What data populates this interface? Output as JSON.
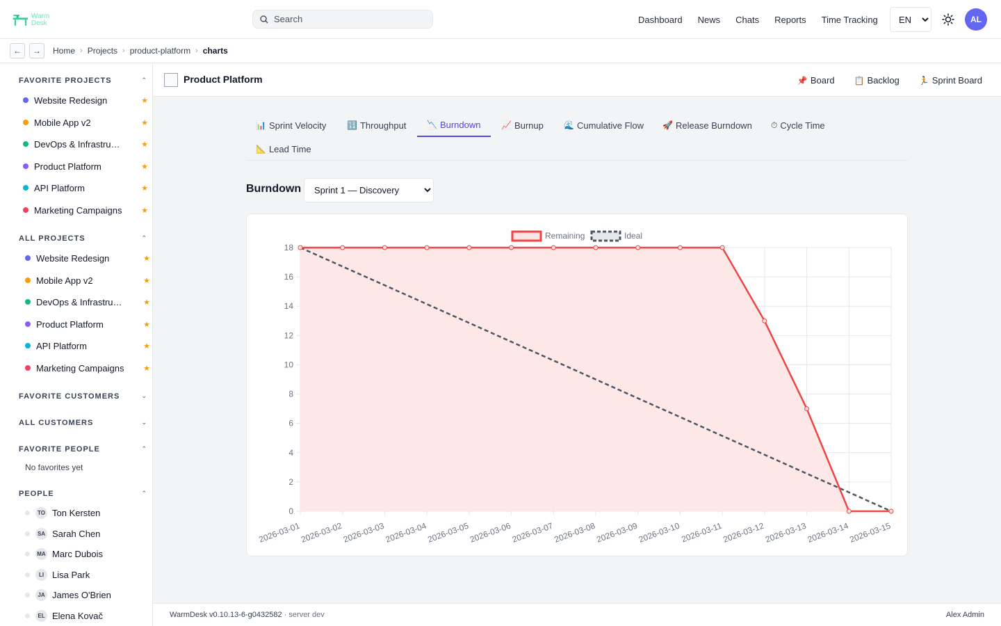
{
  "header": {
    "logo_text": "Warm Desk",
    "search_placeholder": "Search",
    "nav": [
      "Dashboard",
      "News",
      "Chats",
      "Reports",
      "Time Tracking"
    ],
    "language": "EN",
    "avatar_initials": "AL",
    "accent_color": "#6366f1"
  },
  "breadcrumb": {
    "back": "←",
    "forward": "→",
    "items": [
      "Home",
      "Projects",
      "product-platform"
    ],
    "current": "charts"
  },
  "sidebar": {
    "favorite_projects": {
      "title": "FAVORITE PROJECTS",
      "items": [
        {
          "label": "Website Redesign",
          "color": "#6366f1"
        },
        {
          "label": "Mobile App v2",
          "color": "#f59e0b"
        },
        {
          "label": "DevOps & Infrastructure",
          "color": "#10b981"
        },
        {
          "label": "Product Platform",
          "color": "#8b5cf6"
        },
        {
          "label": "API Platform",
          "color": "#06b6d4"
        },
        {
          "label": "Marketing Campaigns",
          "color": "#f43f5e"
        }
      ]
    },
    "all_projects": {
      "title": "ALL PROJECTS",
      "items": [
        {
          "label": "Website Redesign",
          "color": "#6366f1"
        },
        {
          "label": "Mobile App v2",
          "color": "#f59e0b"
        },
        {
          "label": "DevOps & Infrastructure",
          "color": "#10b981"
        },
        {
          "label": "Product Platform",
          "color": "#8b5cf6"
        },
        {
          "label": "API Platform",
          "color": "#06b6d4"
        },
        {
          "label": "Marketing Campaigns",
          "color": "#f43f5e"
        }
      ]
    },
    "favorite_customers": {
      "title": "FAVORITE CUSTOMERS"
    },
    "all_customers": {
      "title": "ALL CUSTOMERS"
    },
    "favorite_people": {
      "title": "FAVORITE PEOPLE",
      "empty": "No favorites yet"
    },
    "people": {
      "title": "PEOPLE",
      "items": [
        {
          "initials": "TO",
          "name": "Ton Kersten"
        },
        {
          "initials": "SA",
          "name": "Sarah Chen"
        },
        {
          "initials": "MA",
          "name": "Marc Dubois"
        },
        {
          "initials": "LI",
          "name": "Lisa Park"
        },
        {
          "initials": "JA",
          "name": "James O'Brien"
        },
        {
          "initials": "EL",
          "name": "Elena Kovač"
        }
      ]
    }
  },
  "project": {
    "title": "Product Platform",
    "actions": [
      {
        "icon": "pin-icon",
        "label": "Board"
      },
      {
        "icon": "clipboard-icon",
        "label": "Backlog"
      },
      {
        "icon": "runner-icon",
        "label": "Sprint Board"
      }
    ]
  },
  "tabs": [
    {
      "icon": "📊",
      "label": "Sprint Velocity"
    },
    {
      "icon": "🔢",
      "label": "Throughput"
    },
    {
      "icon": "📉",
      "label": "Burndown",
      "active": true
    },
    {
      "icon": "📈",
      "label": "Burnup"
    },
    {
      "icon": "🌊",
      "label": "Cumulative Flow"
    },
    {
      "icon": "🚀",
      "label": "Release Burndown"
    },
    {
      "icon": "⏱",
      "label": "Cycle Time"
    },
    {
      "icon": "📐",
      "label": "Lead Time"
    }
  ],
  "burndown": {
    "heading": "Burndown",
    "sprint_selected": "Sprint 1 — Discovery"
  },
  "chart_data": {
    "type": "line",
    "x": [
      "2026-03-01",
      "2026-03-02",
      "2026-03-03",
      "2026-03-04",
      "2026-03-05",
      "2026-03-06",
      "2026-03-07",
      "2026-03-08",
      "2026-03-09",
      "2026-03-10",
      "2026-03-11",
      "2026-03-12",
      "2026-03-13",
      "2026-03-14",
      "2026-03-15"
    ],
    "series": [
      {
        "name": "Remaining",
        "values": [
          18,
          18,
          18,
          18,
          18,
          18,
          18,
          18,
          18,
          18,
          18,
          13,
          7,
          0,
          0
        ],
        "color": "#ef4444",
        "fill": "#fde4e4",
        "style": "solid"
      },
      {
        "name": "Ideal",
        "values": [
          18,
          16.71,
          15.43,
          14.14,
          12.86,
          11.57,
          10.29,
          9,
          7.71,
          6.43,
          5.14,
          3.86,
          2.57,
          1.29,
          0
        ],
        "color": "#4b5563",
        "style": "dashed"
      }
    ],
    "ylim": [
      0,
      18
    ],
    "yticks": [
      0,
      2,
      4,
      6,
      8,
      10,
      12,
      14,
      16,
      18
    ],
    "grid": true,
    "legend": "top-center"
  },
  "footer": {
    "version": "WarmDesk v0.10.13-6-g0432582",
    "server": "· server dev",
    "user": "Alex Admin"
  }
}
